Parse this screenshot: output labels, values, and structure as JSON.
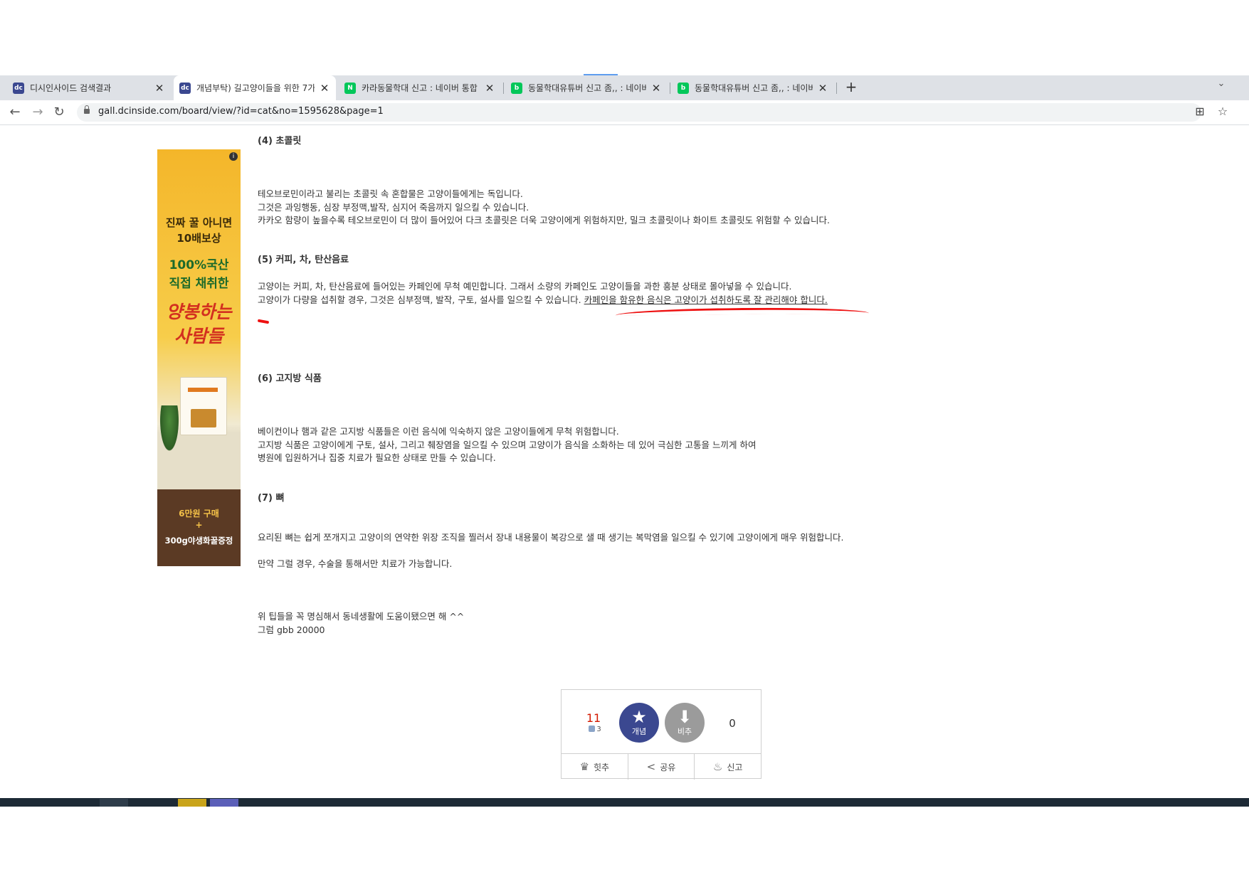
{
  "tabs": [
    {
      "title": "디시인사이드 검색결과",
      "icon": "dc-favicon",
      "active": false
    },
    {
      "title": "개념부탁) 길고양이들을 위한 7가",
      "icon": "dc-favicon",
      "active": true
    },
    {
      "title": "카라동물학대 신고 : 네이버 통합",
      "icon": "naver-favicon",
      "active": false
    },
    {
      "title": "동물학대유튜버 신고 좀,, : 네이버",
      "icon": "naver-blog-favicon",
      "active": false
    },
    {
      "title": "동물학대유튜버 신고 좀,, : 네이버",
      "icon": "naver-blog-favicon",
      "active": false
    }
  ],
  "toolbar": {
    "url": "gall.dcinside.com/board/view/?id=cat&no=1595628&page=1"
  },
  "ad": {
    "line1": "진짜 꿀 아니면",
    "line2": "10배보상",
    "line3": "100%국산",
    "line4": "직접 채취한",
    "line5": "양봉하는",
    "line6": "사람들",
    "line7": "6만원 구매",
    "line8": "+",
    "line9": "300g야생화꿀증정"
  },
  "article": {
    "s4_title": "(4) 초콜릿",
    "s4_p1": "테오브로민이라고 불리는 초콜릿 속 혼합물은 고양이들에게는 독입니다.",
    "s4_p2": "그것은 과잉행동, 심장 부정맥,발작, 심지어 죽음까지 일으킬 수 있습니다.",
    "s4_p3": "카카오 함량이 높을수록 테오브로민이 더 많이 들어있어 다크 초콜릿은 더욱 고양이에게 위험하지만, 밀크 초콜릿이나 화이트 초콜릿도 위험할 수 있습니다.",
    "s5_title": "(5) 커피, 차, 탄산음료",
    "s5_p1": "고양이는 커피, 차, 탄산음료에 들어있는 카페인에 무척 예민합니다. 그래서 소량의 카페인도 고양이들을 과한 흥분 상태로 몰아넣을 수 있습니다.",
    "s5_p2a": "고양이가 다량을 섭취할 경우, 그것은 심부정맥, 발작, 구토, 설사를 일으킬 수 있습니다. ",
    "s5_p2b": "카페인을 함유한 음식은 고양이가 섭취하도록 잘 관리해야 합니다.",
    "s6_title": "(6) 고지방 식품",
    "s6_p1": "베이컨이나 햄과 같은 고지방 식품들은 이런 음식에 익숙하지 않은 고양이들에게 무척 위험합니다.",
    "s6_p2": "고지방 식품은 고양이에게 구토, 설사, 그리고 췌장염을 일으킬 수 있으며 고양이가 음식을 소화하는 데 있어 극심한 고통을 느끼게 하여",
    "s6_p3": "병원에 입원하거나 집중 치료가 필요한 상태로 만들 수 있습니다.",
    "s7_title": "(7) 뼈",
    "s7_p1": "요리된 뼈는 쉽게 쪼개지고 고양이의 연약한 위장 조직을 찔러서 장내 내용물이 복강으로 샐 때 생기는 복막염을 일으킬 수 있기에 고양이에게 매우 위험합니다.",
    "s7_p2": "만약 그럴 경우, 수술을 통해서만 치료가 가능합니다.",
    "outro1": "위 팁들을 꼭 명심해서   동네생활에 도움이됐으면 해 ^^",
    "outro2": "그럼 gbb 20000"
  },
  "recommend": {
    "up_count": "11",
    "fixed_count": "3",
    "up_label": "개념",
    "down_label": "비추",
    "down_count": "0",
    "hit_label": "힛추",
    "share_label": "공유",
    "report_label": "신고"
  },
  "colors": {
    "dc_blue": "#3b4890",
    "naver_green": "#03c75a",
    "red_mark": "#ee1111",
    "recommend_red": "#d31900"
  }
}
